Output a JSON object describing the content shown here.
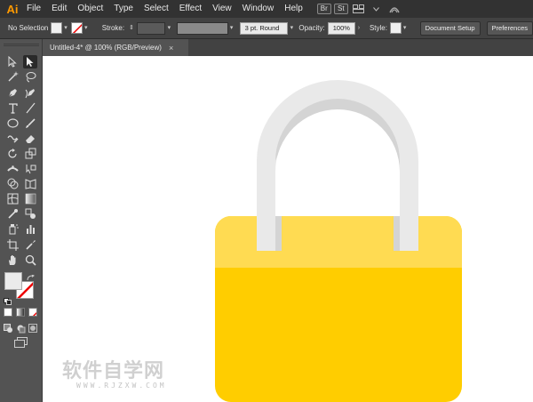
{
  "app": {
    "logo": "Ai"
  },
  "menu": [
    "File",
    "Edit",
    "Object",
    "Type",
    "Select",
    "Effect",
    "View",
    "Window",
    "Help"
  ],
  "menu_chips": [
    "Br",
    "St"
  ],
  "control": {
    "selection": "No Selection",
    "stroke_label": "Stroke:",
    "brush": "3 pt. Round",
    "opacity_label": "Opacity:",
    "opacity_value": "100%",
    "style_label": "Style:",
    "document_setup": "Document Setup",
    "preferences": "Preferences"
  },
  "tab": {
    "title": "Untitled-4* @ 100% (RGB/Preview)",
    "close": "×"
  },
  "watermark": {
    "main": "软件自学网",
    "sub": "WWW.RJZXW.COM"
  },
  "colors": {
    "lock_body": "#ffcd00",
    "lock_body_top": "#ffda50",
    "shackle_light": "#e9e9e9",
    "shackle_dark": "#cfcfcf",
    "app_bg": "#535353",
    "menubar": "#323232",
    "accent": "#ff9a00"
  },
  "icons": [
    "selection-tool-icon",
    "direct-selection-tool-icon",
    "magic-wand-icon",
    "lasso-icon",
    "pen-tool-icon",
    "curvature-icon",
    "type-tool-icon",
    "line-tool-icon",
    "ellipse-tool-icon",
    "paintbrush-icon",
    "shaper-icon",
    "eraser-icon",
    "rotate-icon",
    "scale-icon",
    "width-tool-icon",
    "free-transform-icon",
    "shape-builder-icon",
    "perspective-icon",
    "mesh-icon",
    "gradient-icon",
    "eyedropper-icon",
    "blend-icon",
    "symbol-sprayer-icon",
    "graph-icon",
    "artboard-icon",
    "slice-icon",
    "hand-icon",
    "zoom-icon"
  ]
}
